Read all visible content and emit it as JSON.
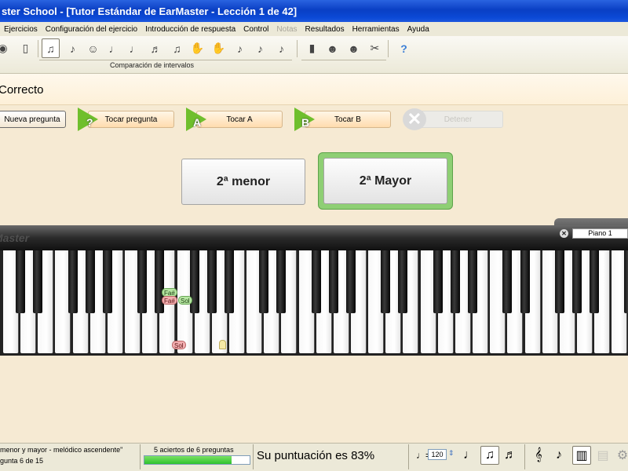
{
  "window": {
    "title": "ster School - [Tutor Estándar de EarMaster - Lección 1 de 42]"
  },
  "menu": {
    "items": [
      {
        "label": "Ejercicios",
        "enabled": true
      },
      {
        "label": "Configuración del ejercicio",
        "enabled": true
      },
      {
        "label": "Introducción de respuesta",
        "enabled": true
      },
      {
        "label": "Control",
        "enabled": true
      },
      {
        "label": "Notas",
        "enabled": false
      },
      {
        "label": "Resultados",
        "enabled": true
      },
      {
        "label": "Herramientas",
        "enabled": true
      },
      {
        "label": "Ayuda",
        "enabled": true
      }
    ]
  },
  "toolbar": {
    "group_label": "Comparación de intervalos"
  },
  "status": {
    "title": "Correcto"
  },
  "actions": {
    "new_question": "Nueva pregunta",
    "play_question": "Tocar pregunta",
    "play_a": "Tocar A",
    "play_b": "Tocar B",
    "stop": "Detener",
    "play_question_letter": "?",
    "play_a_letter": "A",
    "play_b_letter": "B"
  },
  "answers": {
    "a": "2ª menor",
    "b": "2ª Mayor",
    "selected": "b"
  },
  "piano": {
    "brand": "Master",
    "instrument": "Piano 1",
    "markers": {
      "upper_green": "Fa#",
      "lower_red": "Fa#",
      "sol_green": "Sol",
      "sol_red": "Sol"
    }
  },
  "statusbar": {
    "exercise": "menor y mayor - melódico ascendente\"",
    "question": "gunta 6 de 15",
    "result": "5 aciertos de 6 preguntas",
    "progress": 0.83,
    "score": "Su puntuación es 83%",
    "tempo_symbol": "♩=",
    "tempo": "120"
  },
  "colors": {
    "accent_green": "#8ecf74",
    "play_green": "#6fbf2d",
    "background": "#f6ead3"
  }
}
